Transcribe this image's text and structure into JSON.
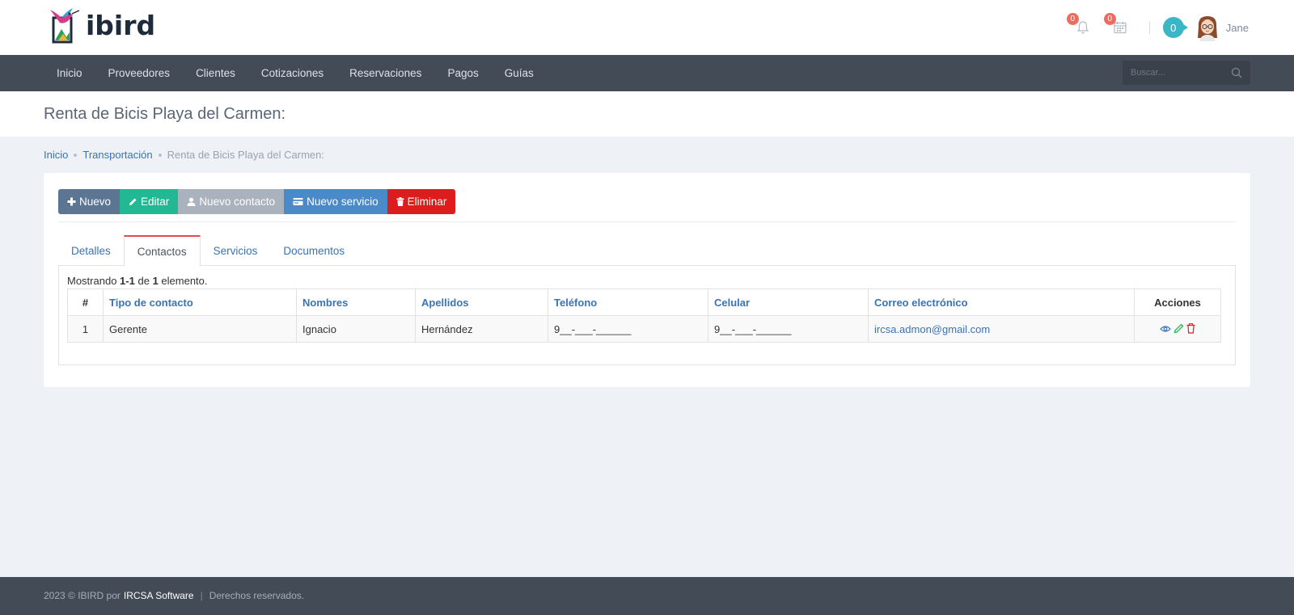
{
  "brand": {
    "logo_text": "ibird"
  },
  "header": {
    "notifications_count": "0",
    "calendar_count": "0",
    "cart_count": "0",
    "username": "Jane"
  },
  "nav": {
    "items": [
      "Inicio",
      "Proveedores",
      "Clientes",
      "Cotizaciones",
      "Reservaciones",
      "Pagos",
      "Guías"
    ],
    "search_placeholder": "Buscar..."
  },
  "page": {
    "title": "Renta de Bicis Playa del Carmen:"
  },
  "breadcrumb": {
    "items": [
      "Inicio",
      "Transportación"
    ],
    "current": "Renta de Bicis Playa del Carmen:"
  },
  "toolbar": {
    "nuevo": "Nuevo",
    "editar": "Editar",
    "nuevo_contacto": "Nuevo contacto",
    "nuevo_servicio": "Nuevo servicio",
    "eliminar": "Eliminar"
  },
  "tabs": [
    "Detalles",
    "Contactos",
    "Servicios",
    "Documentos"
  ],
  "active_tab": "Contactos",
  "summary": {
    "prefix": "Mostrando",
    "range": "1-1",
    "of": "de",
    "total": "1",
    "suffix": "elemento."
  },
  "table": {
    "headers": [
      "#",
      "Tipo de contacto",
      "Nombres",
      "Apellidos",
      "Teléfono",
      "Celular",
      "Correo electrónico",
      "Acciones"
    ],
    "rows": [
      [
        "1",
        "Gerente",
        "Ignacio",
        "Hernández",
        "9__-___-______",
        "9__-___-______",
        "ircsa.admon@gmail.com"
      ]
    ]
  },
  "footer": {
    "copyright": "2023 © IBIRD por",
    "company": "IRCSA Software",
    "separator": "|",
    "rights": "Derechos reservados."
  },
  "colors": {
    "nav_bg": "#434b56",
    "btn_nuevo": "#5c7593",
    "btn_editar": "#22b894",
    "btn_contacto": "#aab3bd",
    "btn_servicio": "#4b8ac8",
    "btn_eliminar": "#dd1c1c",
    "link": "#3a73b5",
    "badge": "#f06a5e",
    "cart": "#3bb6c7"
  },
  "icons": [
    "bell-icon",
    "calendar-icon",
    "search-icon",
    "plus-icon",
    "pencil-icon",
    "user-icon",
    "card-icon",
    "trash-icon",
    "eye-icon"
  ]
}
